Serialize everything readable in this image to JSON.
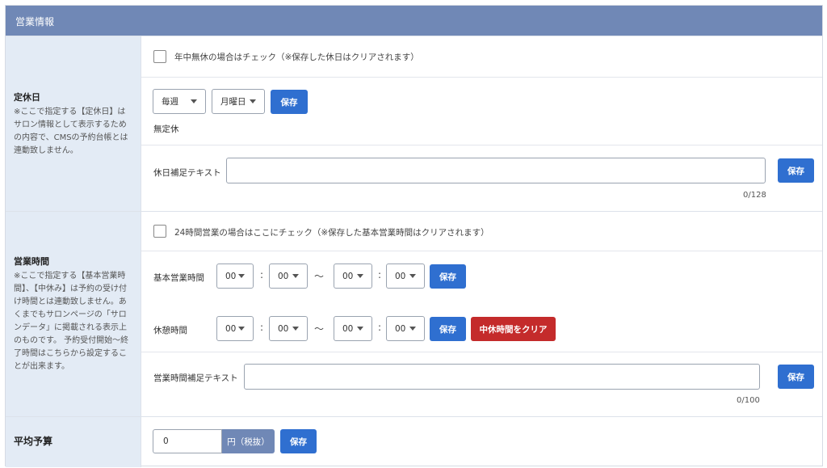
{
  "header": {
    "title": "営業情報"
  },
  "holiday": {
    "title": "定休日",
    "note": "※ここで指定する【定休日】はサロン情報として表示するための内容で、CMSの予約台帳とは連動致しません。",
    "no_holiday_check_label": "年中無休の場合はチェック（※保存した休日はクリアされます）",
    "frequency_value": "毎週",
    "weekday_value": "月曜日",
    "save_label": "保存",
    "status_text": "無定休",
    "supplement_label": "休日補足テキスト",
    "supplement_value": "",
    "supplement_save_label": "保存",
    "supplement_counter": "0/128"
  },
  "hours": {
    "title": "営業時間",
    "note": "※ここで指定する【基本営業時間】、【中休み】は予約の受け付け時間とは連動致しません。あくまでもサロンページの「サロンデータ」に掲載される表示上のものです。 予約受付開始～終了時間はこちらから設定することが出来ます。",
    "open24_check_label": "24時間営業の場合はここにチェック（※保存した基本営業時間はクリアされます）",
    "basic_label": "基本営業時間",
    "basic": {
      "start_hour": "00",
      "start_min": "00",
      "end_hour": "00",
      "end_min": "00"
    },
    "basic_save_label": "保存",
    "break_label": "休憩時間",
    "break": {
      "start_hour": "00",
      "start_min": "00",
      "end_hour": "00",
      "end_min": "00"
    },
    "break_save_label": "保存",
    "break_clear_label": "中休時間をクリア",
    "colon": ":",
    "tilde": "～",
    "supplement_label": "営業時間補足テキスト",
    "supplement_value": "",
    "supplement_save_label": "保存",
    "supplement_counter": "0/100"
  },
  "budget": {
    "title": "平均予算",
    "value": "0",
    "unit_label": "円（税抜）",
    "save_label": "保存"
  },
  "colors": {
    "header_bg": "#7088b6",
    "label_bg": "#e3ebf5",
    "primary_button": "#2f6fd0",
    "danger_button": "#c42b2b"
  }
}
